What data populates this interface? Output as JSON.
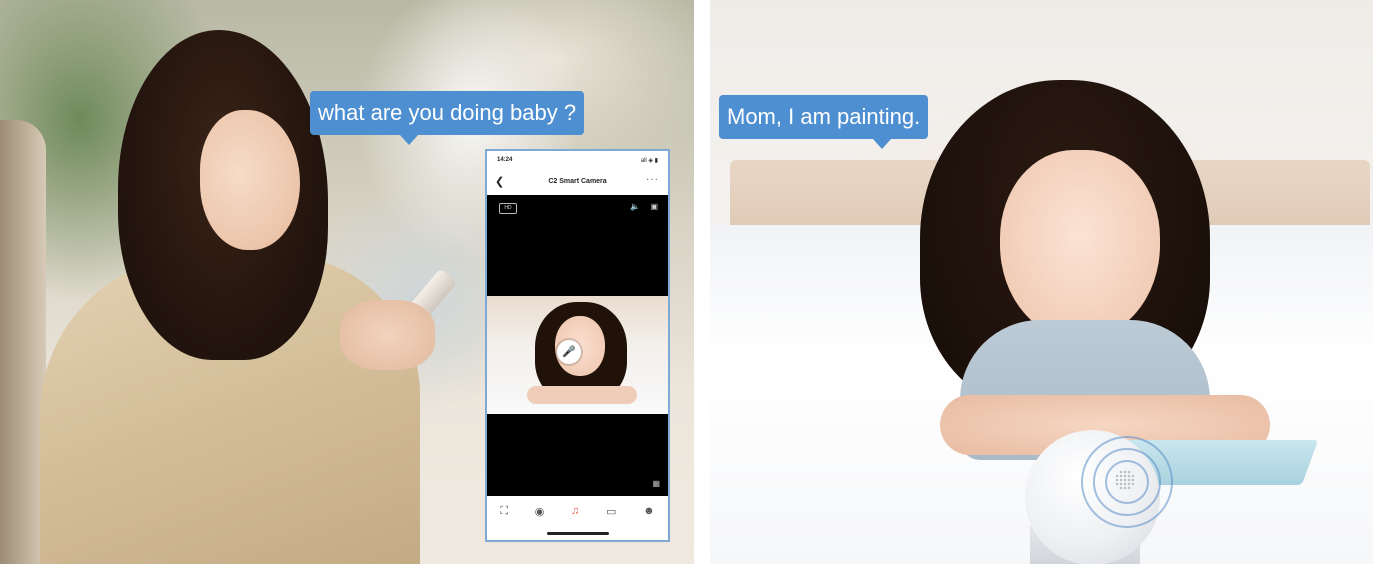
{
  "bubbles": {
    "mom": "what are you doing baby ?",
    "girl": "Mom, I am painting."
  },
  "phone_app": {
    "status_time": "14:24",
    "status_icons": "all ◈ ▮",
    "title": "C2 Smart Camera",
    "back_icon": "chevron-left-icon",
    "more_icon": "more-icon",
    "hd_label": "HD",
    "toolbar_icons": [
      "screenshot-icon",
      "camera-icon",
      "alarm-icon",
      "record-icon",
      "person-icon"
    ]
  },
  "colors": {
    "bubble_blue": "#4d8fd1",
    "phone_border": "#7ea9d6",
    "active_icon": "#ef5a4a"
  }
}
